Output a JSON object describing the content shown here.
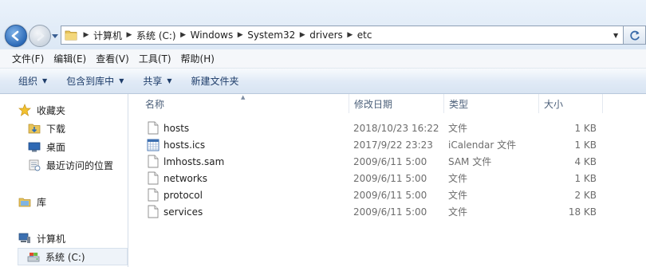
{
  "address": {
    "breadcrumbs": [
      "计算机",
      "系统 (C:)",
      "Windows",
      "System32",
      "drivers",
      "etc"
    ]
  },
  "menu": [
    "文件(F)",
    "编辑(E)",
    "查看(V)",
    "工具(T)",
    "帮助(H)"
  ],
  "commands": {
    "organize": "组织",
    "include_in_library": "包含到库中",
    "share": "共享",
    "new_folder": "新建文件夹"
  },
  "nav": {
    "favorites": "收藏夹",
    "downloads": "下载",
    "desktop": "桌面",
    "recent_places": "最近访问的位置",
    "libraries": "库",
    "computer": "计算机",
    "system_drive": "系统 (C:)"
  },
  "columns": {
    "name": "名称",
    "date_modified": "修改日期",
    "type": "类型",
    "size": "大小"
  },
  "files": [
    {
      "name": "hosts",
      "date": "2018/10/23 16:22",
      "type": "文件",
      "size": "1 KB",
      "icon": "file-icon"
    },
    {
      "name": "hosts.ics",
      "date": "2017/9/22 23:23",
      "type": "iCalendar 文件",
      "size": "1 KB",
      "icon": "calendar-file-icon"
    },
    {
      "name": "lmhosts.sam",
      "date": "2009/6/11 5:00",
      "type": "SAM 文件",
      "size": "4 KB",
      "icon": "file-icon"
    },
    {
      "name": "networks",
      "date": "2009/6/11 5:00",
      "type": "文件",
      "size": "1 KB",
      "icon": "file-icon"
    },
    {
      "name": "protocol",
      "date": "2009/6/11 5:00",
      "type": "文件",
      "size": "2 KB",
      "icon": "file-icon"
    },
    {
      "name": "services",
      "date": "2009/6/11 5:00",
      "type": "文件",
      "size": "18 KB",
      "icon": "file-icon"
    }
  ]
}
